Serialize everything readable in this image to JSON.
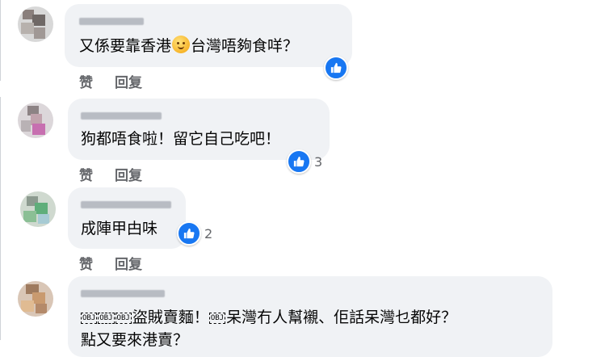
{
  "comments": [
    {
      "text_before_emoji": "又係要靠香港",
      "text_after_emoji": "台灣唔夠食咩？",
      "emoji": "thinking-face-emoji",
      "reaction_icon": "like-icon",
      "reaction_count": "",
      "actions": {
        "like": "赞",
        "reply": "回复"
      }
    },
    {
      "text": "狗都唔食啦！留它自己吃吧！",
      "reaction_icon": "like-icon",
      "reaction_count": "3",
      "actions": {
        "like": "赞",
        "reply": "回复"
      }
    },
    {
      "text": "成陣甲甴味",
      "reaction_icon": "like-icon",
      "reaction_count": "2",
      "actions": {
        "like": "赞",
        "reply": "回复"
      }
    },
    {
      "obj_glyph": "OBJ",
      "text_part1": "盜賊賣麵！",
      "text_part2": "呆灣冇人幫襯、佢話呆灣乜都好？",
      "text_line2": "點又要來港賣？"
    }
  ],
  "colors": {
    "like_blue": "#1877f2",
    "bubble": "#f0f2f5",
    "muted": "#65676b"
  }
}
